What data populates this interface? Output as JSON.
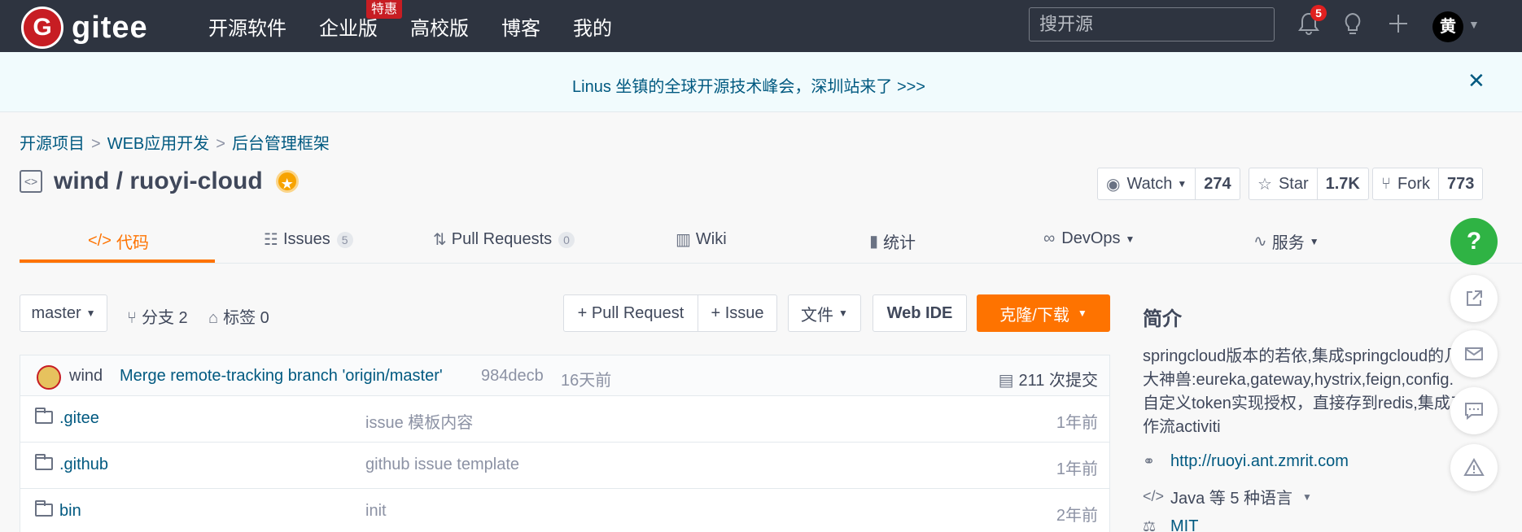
{
  "topnav": {
    "logo_text": "gitee",
    "logo_mark": "G",
    "items": [
      "开源软件",
      "企业版",
      "高校版",
      "博客",
      "我的"
    ],
    "hot_badge": "特惠",
    "search_placeholder": "搜开源",
    "notif_count": "5",
    "avatar_text": "黄"
  },
  "banner": {
    "text": "Linus 坐镇的全球开源技术峰会，深圳站来了 >>>",
    "close": "✕"
  },
  "breadcrumb": [
    "开源项目",
    "WEB应用开发",
    "后台管理框架"
  ],
  "breadcrumb_sep": ">",
  "repo": {
    "name": "wind / ruoyi-cloud",
    "watch_label": "Watch",
    "watch_count": "274",
    "star_label": "Star",
    "star_count": "1.7K",
    "fork_label": "Fork",
    "fork_count": "773"
  },
  "tabs": [
    {
      "label": "代码",
      "count": ""
    },
    {
      "label": "Issues",
      "count": "5"
    },
    {
      "label": "Pull Requests",
      "count": "0"
    },
    {
      "label": "Wiki",
      "count": ""
    },
    {
      "label": "统计",
      "count": ""
    },
    {
      "label": "DevOps",
      "count": ""
    },
    {
      "label": "服务",
      "count": ""
    }
  ],
  "toolbar": {
    "branch": "master",
    "branches": "分支 2",
    "tags": "标签 0",
    "pull_request": "+ Pull Request",
    "issue": "+ Issue",
    "file": "文件",
    "web_ide": "Web IDE",
    "clone": "克隆/下载"
  },
  "commit": {
    "author": "wind",
    "message": "Merge remote-tracking branch 'origin/master'",
    "hash": "984decb",
    "time": "16天前",
    "count": "211 次提交"
  },
  "files": [
    {
      "name": ".gitee",
      "message": "issue 模板内容",
      "time": "1年前"
    },
    {
      "name": ".github",
      "message": "github issue template",
      "time": "1年前"
    },
    {
      "name": "bin",
      "message": "init",
      "time": "2年前"
    }
  ],
  "sidebar": {
    "title": "简介",
    "desc": "springcloud版本的若依,集成springcloud的几大神兽:eureka,gateway,hystrix,feign,config.自定义token实现授权，直接存到redis,集成工作流activiti",
    "url": "http://ruoyi.ant.zmrit.com",
    "lang": "Java 等 5 种语言",
    "license": "MIT"
  },
  "float": {
    "help": "?"
  },
  "colors": {
    "accent": "#fe7300",
    "nav_bg": "#2e3440",
    "brand": "#c71d23",
    "link": "#005980"
  }
}
